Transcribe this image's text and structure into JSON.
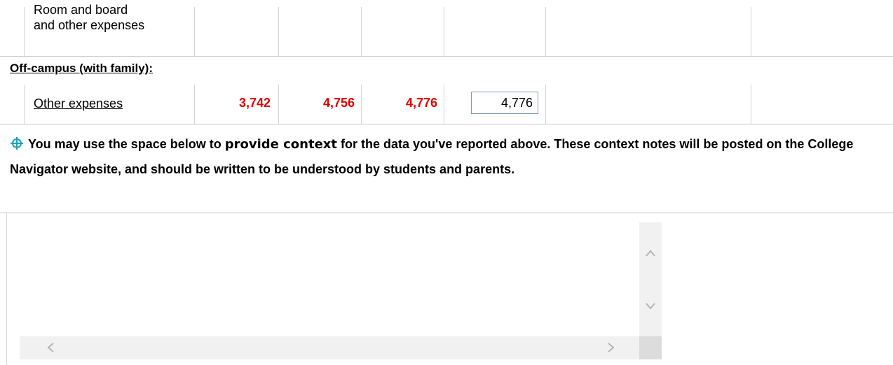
{
  "rows": {
    "room_board": {
      "label_line1": "Room and board",
      "label_line2": "and other expenses"
    },
    "section_off_campus_family": "Off-campus (with family):",
    "other_expenses": {
      "label": "Other expenses",
      "values": [
        "3,742",
        "4,756",
        "4,776"
      ],
      "input_value": "4,776"
    }
  },
  "context_note": {
    "prefix": "You may use the space below to ",
    "emphasis": "provide context",
    "suffix": " for the data you've reported above. These context notes will be posted on the College Navigator website, and should be written to be understood by students and parents."
  },
  "context_textarea": {
    "value": ""
  },
  "colors": {
    "value_red": "#e00000",
    "input_border": "#7f97b5",
    "icon_teal": "#1ea0b4"
  }
}
